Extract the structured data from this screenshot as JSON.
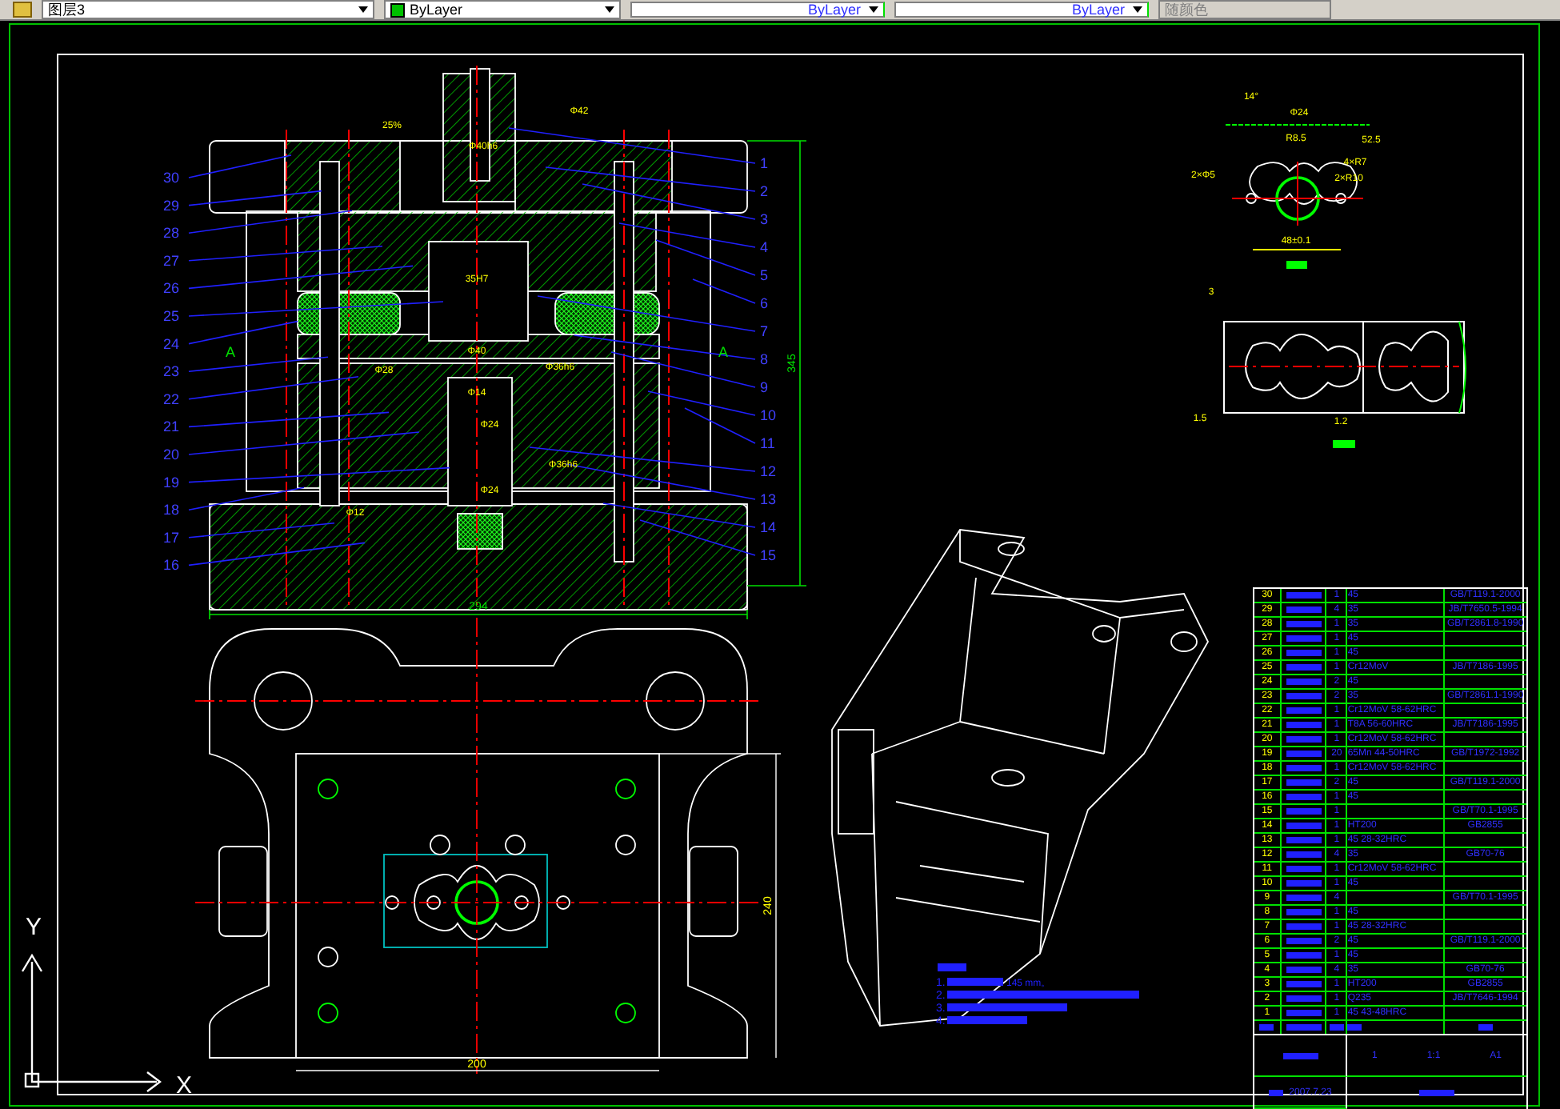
{
  "toolbar": {
    "layer": "图层3",
    "color_control": "ByLayer",
    "linetype": "ByLayer",
    "lineweight": "ByLayer",
    "plot_style": "随颜色"
  },
  "section_view": {
    "right_labels": [
      "1",
      "2",
      "3",
      "4",
      "5",
      "6",
      "7",
      "8",
      "9",
      "10",
      "11",
      "12",
      "13",
      "14",
      "15"
    ],
    "left_labels": [
      "30",
      "29",
      "28",
      "27",
      "26",
      "25",
      "24",
      "23",
      "22",
      "21",
      "20",
      "19",
      "18",
      "17",
      "16"
    ],
    "section_marks": [
      "A",
      "A"
    ],
    "dims": [
      "25%",
      "Φ40h6",
      "Φ42",
      "35H7",
      "Φ28",
      "Φ40",
      "Φ14",
      "Φ36h6",
      "Φ36h6",
      "Φ24",
      "Φ24",
      "Φ12"
    ],
    "width_dim": "294",
    "height_dim": "345"
  },
  "plan_view": {
    "width_dim": "200",
    "height_dim": "240"
  },
  "part_view": {
    "dims": [
      "14°",
      "Φ24",
      "R8.5",
      "52.5",
      "4×R7",
      "2×Φ5",
      "2×R10",
      "48±0.1"
    ]
  },
  "strip_layout": {
    "dims": [
      "3",
      "1.5",
      "1.2"
    ]
  },
  "notes": {
    "items": [
      "1.",
      "2.",
      "3.",
      "4."
    ],
    "value": "145 mm。"
  },
  "parts_list": {
    "rows": [
      {
        "no": "30",
        "qty": "1",
        "material": "45",
        "standard": "GB/T119.1-2000"
      },
      {
        "no": "29",
        "qty": "4",
        "material": "35",
        "standard": "JB/T7650.5-1994"
      },
      {
        "no": "28",
        "qty": "1",
        "material": "35",
        "standard": "GB/T2861.8-1990"
      },
      {
        "no": "27",
        "qty": "1",
        "material": "45",
        "standard": ""
      },
      {
        "no": "26",
        "qty": "1",
        "material": "45",
        "standard": ""
      },
      {
        "no": "25",
        "qty": "1",
        "material": "Cr12MoV",
        "standard": "JB/T7186-1995"
      },
      {
        "no": "24",
        "qty": "2",
        "material": "45",
        "standard": ""
      },
      {
        "no": "23",
        "qty": "2",
        "material": "35",
        "standard": "GB/T2861.1-1990"
      },
      {
        "no": "22",
        "qty": "1",
        "material": "Cr12MoV 58-62HRC",
        "standard": ""
      },
      {
        "no": "21",
        "qty": "1",
        "material": "T8A 56-60HRC",
        "standard": "JB/T7186-1995"
      },
      {
        "no": "20",
        "qty": "1",
        "material": "Cr12MoV 58-62HRC",
        "standard": ""
      },
      {
        "no": "19",
        "qty": "20",
        "material": "65Mn 44-50HRC",
        "standard": "GB/T1972-1992"
      },
      {
        "no": "18",
        "qty": "1",
        "material": "Cr12MoV 58-62HRC",
        "standard": ""
      },
      {
        "no": "17",
        "qty": "2",
        "material": "45",
        "standard": "GB/T119.1-2000"
      },
      {
        "no": "16",
        "qty": "1",
        "material": "45",
        "standard": ""
      },
      {
        "no": "15",
        "qty": "1",
        "material": "",
        "standard": "GB/T70.1-1995"
      },
      {
        "no": "14",
        "qty": "1",
        "material": "HT200",
        "standard": "GB2855"
      },
      {
        "no": "13",
        "qty": "1",
        "material": "45 28-32HRC",
        "standard": ""
      },
      {
        "no": "12",
        "qty": "4",
        "material": "35",
        "standard": "GB70-76"
      },
      {
        "no": "11",
        "qty": "1",
        "material": "Cr12MoV 58-62HRC",
        "standard": ""
      },
      {
        "no": "10",
        "qty": "1",
        "material": "45",
        "standard": ""
      },
      {
        "no": "9",
        "qty": "4",
        "material": "",
        "standard": "GB/T70.1-1995"
      },
      {
        "no": "8",
        "qty": "1",
        "material": "45",
        "standard": ""
      },
      {
        "no": "7",
        "qty": "1",
        "material": "45 28-32HRC",
        "standard": ""
      },
      {
        "no": "6",
        "qty": "2",
        "material": "45",
        "standard": "GB/T119.1-2000"
      },
      {
        "no": "5",
        "qty": "1",
        "material": "45",
        "standard": ""
      },
      {
        "no": "4",
        "qty": "4",
        "material": "35",
        "standard": "GB70-76"
      },
      {
        "no": "3",
        "qty": "1",
        "material": "HT200",
        "standard": "GB2855"
      },
      {
        "no": "2",
        "qty": "1",
        "material": "Q235",
        "standard": "JB/T7646-1994"
      },
      {
        "no": "1",
        "qty": "1",
        "material": "45 43-48HRC",
        "standard": ""
      }
    ],
    "footer": {
      "count": "1",
      "scale": "1:1",
      "sheet": "A1",
      "date": "2007.7.23"
    }
  },
  "ucs": {
    "x": "X",
    "y": "Y"
  }
}
